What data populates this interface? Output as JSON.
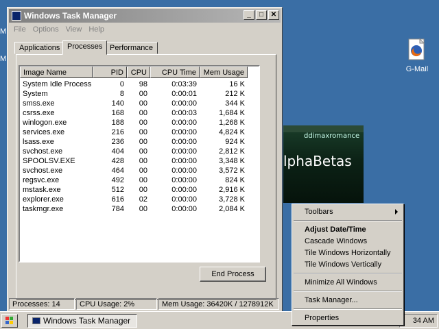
{
  "window": {
    "title": "Windows Task Manager",
    "menu": [
      "File",
      "Options",
      "View",
      "Help"
    ],
    "tabs": [
      "Applications",
      "Processes",
      "Performance"
    ],
    "active_tab": "Processes",
    "columns": [
      "Image Name",
      "PID",
      "CPU",
      "CPU Time",
      "Mem Usage"
    ],
    "processes": [
      {
        "name": "System Idle Process",
        "pid": "0",
        "cpu": "98",
        "time": "0:03:39",
        "mem": "16 K"
      },
      {
        "name": "System",
        "pid": "8",
        "cpu": "00",
        "time": "0:00:01",
        "mem": "212 K"
      },
      {
        "name": "smss.exe",
        "pid": "140",
        "cpu": "00",
        "time": "0:00:00",
        "mem": "344 K"
      },
      {
        "name": "csrss.exe",
        "pid": "168",
        "cpu": "00",
        "time": "0:00:03",
        "mem": "1,684 K"
      },
      {
        "name": "winlogon.exe",
        "pid": "188",
        "cpu": "00",
        "time": "0:00:00",
        "mem": "1,268 K"
      },
      {
        "name": "services.exe",
        "pid": "216",
        "cpu": "00",
        "time": "0:00:00",
        "mem": "4,824 K"
      },
      {
        "name": "lsass.exe",
        "pid": "236",
        "cpu": "00",
        "time": "0:00:00",
        "mem": "924 K"
      },
      {
        "name": "svchost.exe",
        "pid": "404",
        "cpu": "00",
        "time": "0:00:00",
        "mem": "2,812 K"
      },
      {
        "name": "SPOOLSV.EXE",
        "pid": "428",
        "cpu": "00",
        "time": "0:00:00",
        "mem": "3,348 K"
      },
      {
        "name": "svchost.exe",
        "pid": "464",
        "cpu": "00",
        "time": "0:00:00",
        "mem": "3,572 K"
      },
      {
        "name": "regsvc.exe",
        "pid": "492",
        "cpu": "00",
        "time": "0:00:00",
        "mem": "824 K"
      },
      {
        "name": "mstask.exe",
        "pid": "512",
        "cpu": "00",
        "time": "0:00:00",
        "mem": "2,916 K"
      },
      {
        "name": "explorer.exe",
        "pid": "616",
        "cpu": "02",
        "time": "0:00:00",
        "mem": "3,728 K"
      },
      {
        "name": "taskmgr.exe",
        "pid": "784",
        "cpu": "00",
        "time": "0:00:00",
        "mem": "2,084 K"
      }
    ],
    "end_process_label": "End Process",
    "status": {
      "processes": "Processes: 14",
      "cpu": "CPU Usage: 2%",
      "mem": "Mem Usage: 36420K / 1278912K"
    }
  },
  "desktop": {
    "gmail_label": "G-Mail",
    "edge_letter_1": "M",
    "edge_letter_2": "M",
    "widget_text_1": "ddimaxromance",
    "widget_text_2": "lphaBetas"
  },
  "taskbar": {
    "task_label": "Windows Task Manager",
    "clock": "34 AM"
  },
  "context_menu": {
    "items": [
      {
        "label": "Toolbars",
        "submenu": true
      },
      {
        "label": "Adjust Date/Time",
        "bold": true
      },
      {
        "label": "Cascade Windows"
      },
      {
        "label": "Tile Windows Horizontally"
      },
      {
        "label": "Tile Windows Vertically"
      },
      {
        "label": "Minimize All Windows"
      },
      {
        "label": "Task Manager..."
      },
      {
        "label": "Properties"
      }
    ]
  }
}
